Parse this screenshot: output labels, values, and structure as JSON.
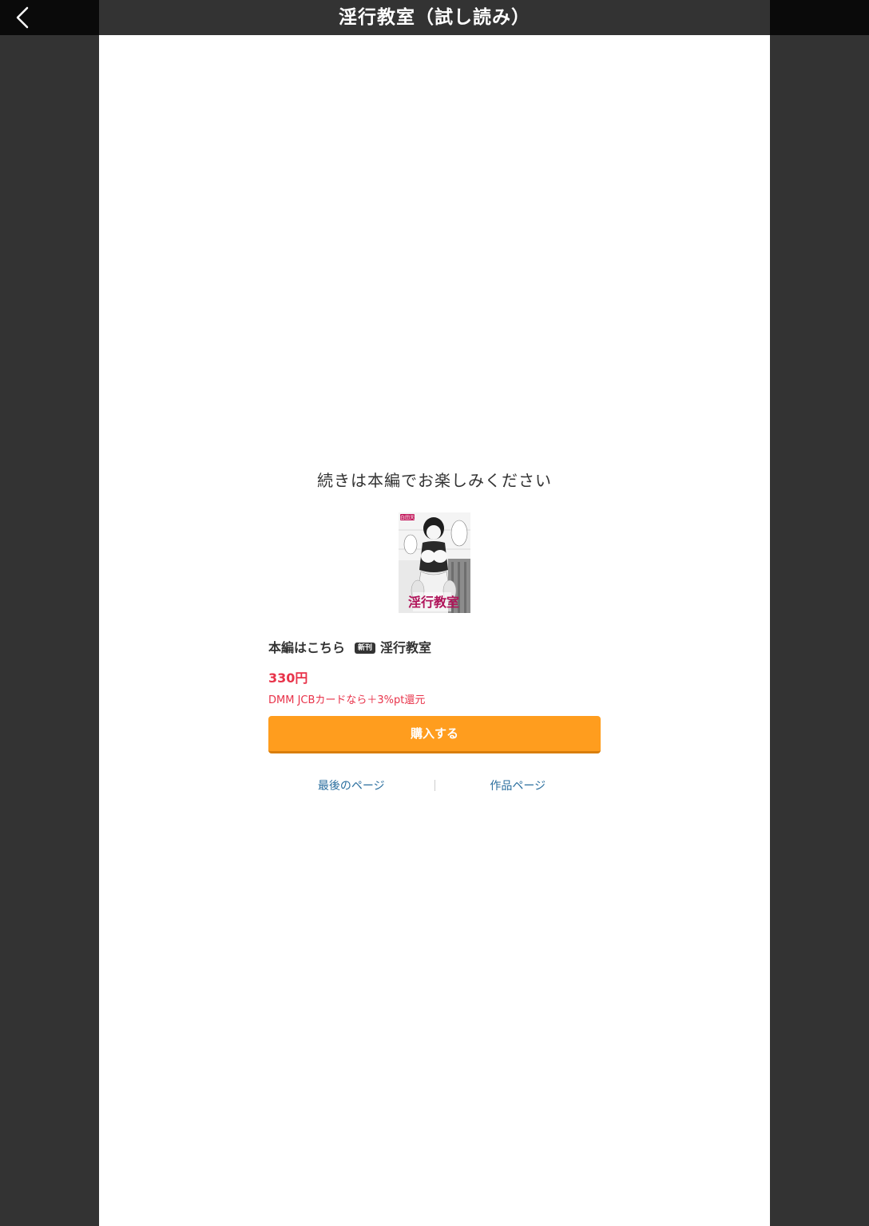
{
  "header": {
    "title": "淫行教室（試し読み）",
    "back_icon": "chevron-left-icon"
  },
  "main": {
    "continue_message": "続きは本編でお楽しみください",
    "product": {
      "lead_label": "本編はこちら",
      "badge": "新刊",
      "title": "淫行教室",
      "price": "330円",
      "campaign": "DMM JCBカードなら＋3%pt還元",
      "buy_label": "購入する",
      "cover": {
        "publisher_label": "白田天",
        "title_text": "淫行教室"
      }
    },
    "links": {
      "last_page": "最後のページ",
      "product_page": "作品ページ"
    }
  },
  "colors": {
    "accent": "#ff9d1e",
    "price": "#e8334a",
    "link": "#2a6e9e",
    "bar": "#333333"
  }
}
